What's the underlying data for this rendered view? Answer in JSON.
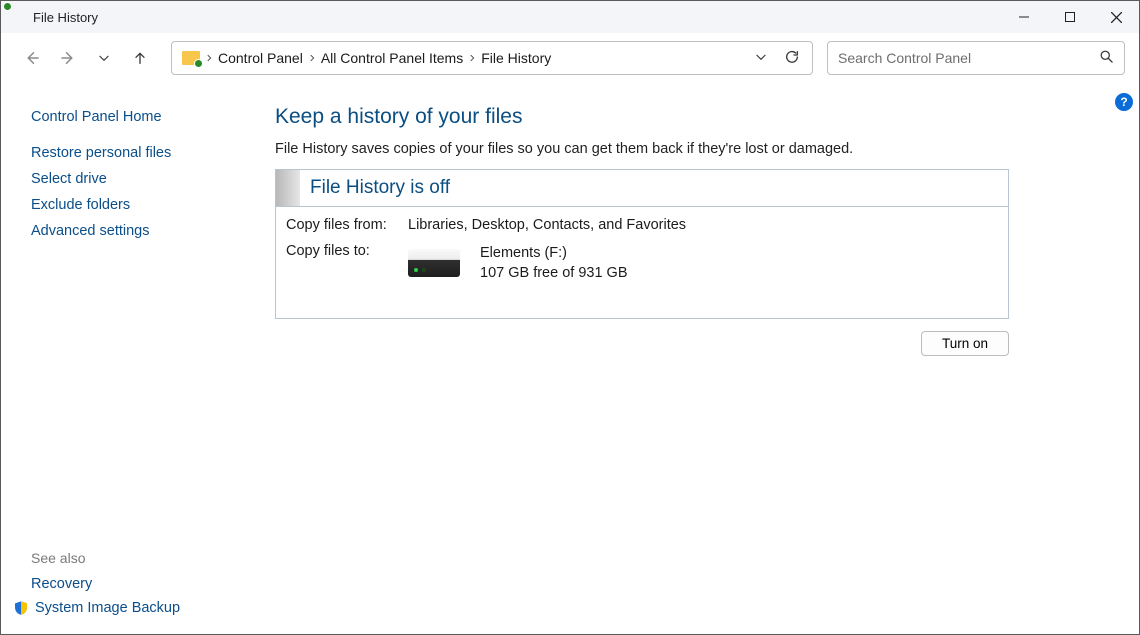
{
  "titlebar": {
    "title": "File History"
  },
  "nav": {
    "breadcrumb": [
      "Control Panel",
      "All Control Panel Items",
      "File History"
    ]
  },
  "search": {
    "placeholder": "Search Control Panel"
  },
  "sidebar": {
    "home": "Control Panel Home",
    "links": [
      "Restore personal files",
      "Select drive",
      "Exclude folders",
      "Advanced settings"
    ],
    "see_also_heading": "See also",
    "see_also": [
      "Recovery",
      "System Image Backup"
    ]
  },
  "main": {
    "heading": "Keep a history of your files",
    "description": "File History saves copies of your files so you can get them back if they're lost or damaged.",
    "panel_title": "File History is off",
    "copy_from_label": "Copy files from:",
    "copy_from_value": "Libraries, Desktop, Contacts, and Favorites",
    "copy_to_label": "Copy files to:",
    "drive_name": "Elements (F:)",
    "drive_space": "107 GB free of 931 GB",
    "turn_on": "Turn on"
  }
}
